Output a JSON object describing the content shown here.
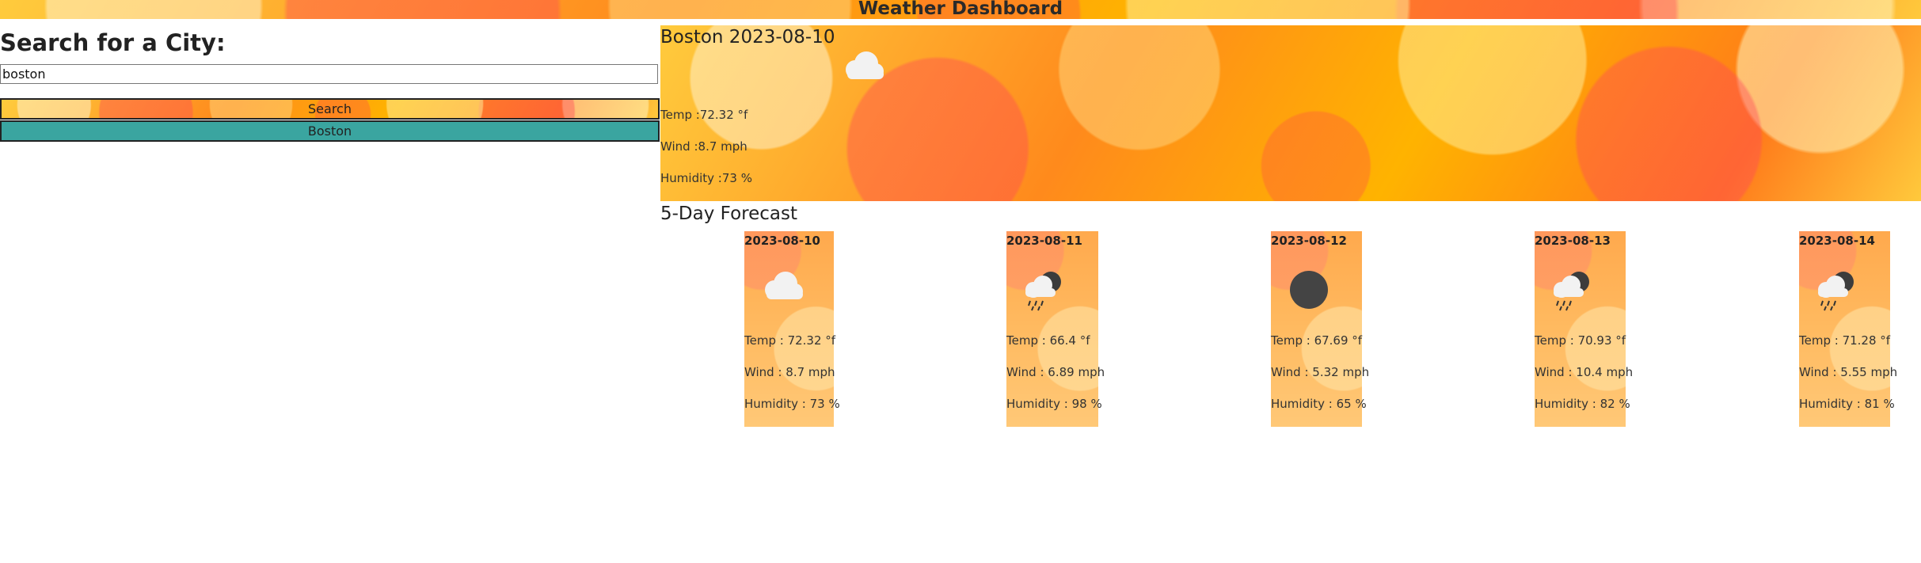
{
  "header": {
    "title": "Weather Dashboard"
  },
  "search": {
    "title": "Search for a City:",
    "input_value": "boston",
    "button_label": "Search",
    "history": [
      "Boston"
    ]
  },
  "current": {
    "city_date": "Boston 2023-08-10",
    "icon": "cloud-icon",
    "temp": "Temp :72.32 °f",
    "wind": "Wind :8.7 mph",
    "humidity": "Humidity :73 %"
  },
  "forecast": {
    "title": "5-Day Forecast",
    "days": [
      {
        "date": "2023-08-10",
        "icon": "cloud-icon",
        "temp": "Temp : 72.32 °f",
        "wind": "Wind : 8.7 mph",
        "humidity": "Humidity : 73 %"
      },
      {
        "date": "2023-08-11",
        "icon": "rain-night-icon",
        "temp": "Temp : 66.4 °f",
        "wind": "Wind : 6.89 mph",
        "humidity": "Humidity : 98 %"
      },
      {
        "date": "2023-08-12",
        "icon": "clear-night-icon",
        "temp": "Temp : 67.69 °f",
        "wind": "Wind : 5.32 mph",
        "humidity": "Humidity : 65 %"
      },
      {
        "date": "2023-08-13",
        "icon": "rain-night-icon",
        "temp": "Temp : 70.93 °f",
        "wind": "Wind : 10.4 mph",
        "humidity": "Humidity : 82 %"
      },
      {
        "date": "2023-08-14",
        "icon": "rain-night-icon",
        "temp": "Temp : 71.28 °f",
        "wind": "Wind : 5.55 mph",
        "humidity": "Humidity : 81 %"
      }
    ]
  },
  "colors": {
    "history_button": "#3aa5a0",
    "accent": "#ffb300"
  }
}
